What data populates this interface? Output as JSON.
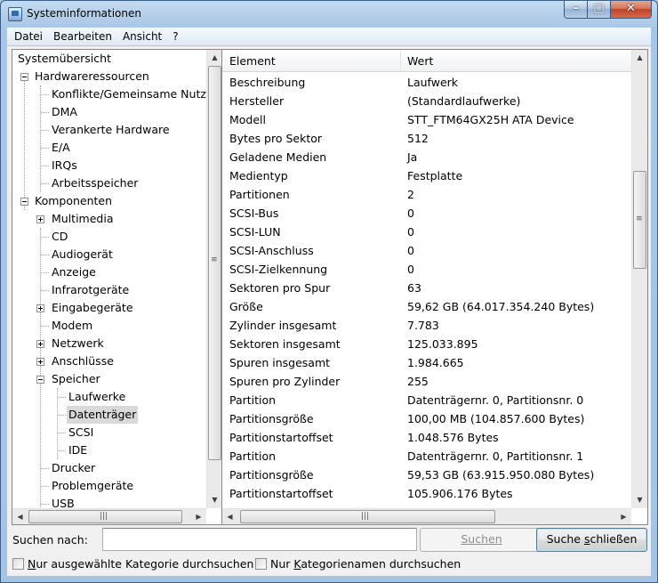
{
  "window": {
    "title": "Systeminformationen"
  },
  "menu": [
    "Datei",
    "Bearbeiten",
    "Ansicht",
    "?"
  ],
  "tree": [
    {
      "label": "Systemübersicht",
      "level": 0,
      "expander": ""
    },
    {
      "label": "Hardwareressourcen",
      "level": 1,
      "expander": "minus"
    },
    {
      "label": "Konflikte/Gemeinsame Nutzur",
      "level": 2,
      "expander": ""
    },
    {
      "label": "DMA",
      "level": 2,
      "expander": ""
    },
    {
      "label": "Verankerte Hardware",
      "level": 2,
      "expander": ""
    },
    {
      "label": "E/A",
      "level": 2,
      "expander": ""
    },
    {
      "label": "IRQs",
      "level": 2,
      "expander": ""
    },
    {
      "label": "Arbeitsspeicher",
      "level": 2,
      "expander": ""
    },
    {
      "label": "Komponenten",
      "level": 1,
      "expander": "minus"
    },
    {
      "label": "Multimedia",
      "level": 2,
      "expander": "plus"
    },
    {
      "label": "CD",
      "level": 2,
      "expander": ""
    },
    {
      "label": "Audiogerät",
      "level": 2,
      "expander": ""
    },
    {
      "label": "Anzeige",
      "level": 2,
      "expander": ""
    },
    {
      "label": "Infrarotgeräte",
      "level": 2,
      "expander": ""
    },
    {
      "label": "Eingabegeräte",
      "level": 2,
      "expander": "plus"
    },
    {
      "label": "Modem",
      "level": 2,
      "expander": ""
    },
    {
      "label": "Netzwerk",
      "level": 2,
      "expander": "plus"
    },
    {
      "label": "Anschlüsse",
      "level": 2,
      "expander": "plus"
    },
    {
      "label": "Speicher",
      "level": 2,
      "expander": "minus"
    },
    {
      "label": "Laufwerke",
      "level": 3,
      "expander": ""
    },
    {
      "label": "Datenträger",
      "level": 3,
      "expander": "",
      "selected": true
    },
    {
      "label": "SCSI",
      "level": 3,
      "expander": ""
    },
    {
      "label": "IDE",
      "level": 3,
      "expander": ""
    },
    {
      "label": "Drucker",
      "level": 2,
      "expander": ""
    },
    {
      "label": "Problemgeräte",
      "level": 2,
      "expander": ""
    },
    {
      "label": "USB",
      "level": 2,
      "expander": ""
    }
  ],
  "list": {
    "columns": [
      "Element",
      "Wert"
    ],
    "rows": [
      [
        "Beschreibung",
        "Laufwerk"
      ],
      [
        "Hersteller",
        "(Standardlaufwerke)"
      ],
      [
        "Modell",
        "STT_FTM64GX25H ATA Device"
      ],
      [
        "Bytes pro Sektor",
        "512"
      ],
      [
        "Geladene Medien",
        "Ja"
      ],
      [
        "Medientyp",
        "Festplatte"
      ],
      [
        "Partitionen",
        "2"
      ],
      [
        "SCSI-Bus",
        "0"
      ],
      [
        "SCSI-LUN",
        "0"
      ],
      [
        "SCSI-Anschluss",
        "0"
      ],
      [
        "SCSI-Zielkennung",
        "0"
      ],
      [
        "Sektoren pro Spur",
        "63"
      ],
      [
        "Größe",
        "59,62 GB (64.017.354.240 Bytes)"
      ],
      [
        "Zylinder insgesamt",
        "7.783"
      ],
      [
        "Sektoren insgesamt",
        "125.033.895"
      ],
      [
        "Spuren insgesamt",
        "1.984.665"
      ],
      [
        "Spuren pro Zylinder",
        "255"
      ],
      [
        "Partition",
        "Datenträgernr. 0, Partitionsnr. 0"
      ],
      [
        "Partitionsgröße",
        "100,00 MB (104.857.600 Bytes)"
      ],
      [
        "Partitionstartoffset",
        "1.048.576 Bytes"
      ],
      [
        "Partition",
        "Datenträgernr. 0, Partitionsnr. 1"
      ],
      [
        "Partitionsgröße",
        "59,53 GB (63.915.950.080 Bytes)"
      ],
      [
        "Partitionstartoffset",
        "105.906.176 Bytes"
      ]
    ]
  },
  "search": {
    "label": "Suchen nach:",
    "value": "",
    "search_button": "Suchen",
    "close_button_prefix": "Suche ",
    "close_button_underlined": "s",
    "close_button_suffix": "chließen"
  },
  "options": {
    "selected_category_only_u": "N",
    "selected_category_only_rest": "ur ausgewählte Kategorie durchsuchen",
    "category_names_only_prefix": "Nur ",
    "category_names_only_u": "K",
    "category_names_only_rest": "ategorienamen durchsuchen"
  }
}
